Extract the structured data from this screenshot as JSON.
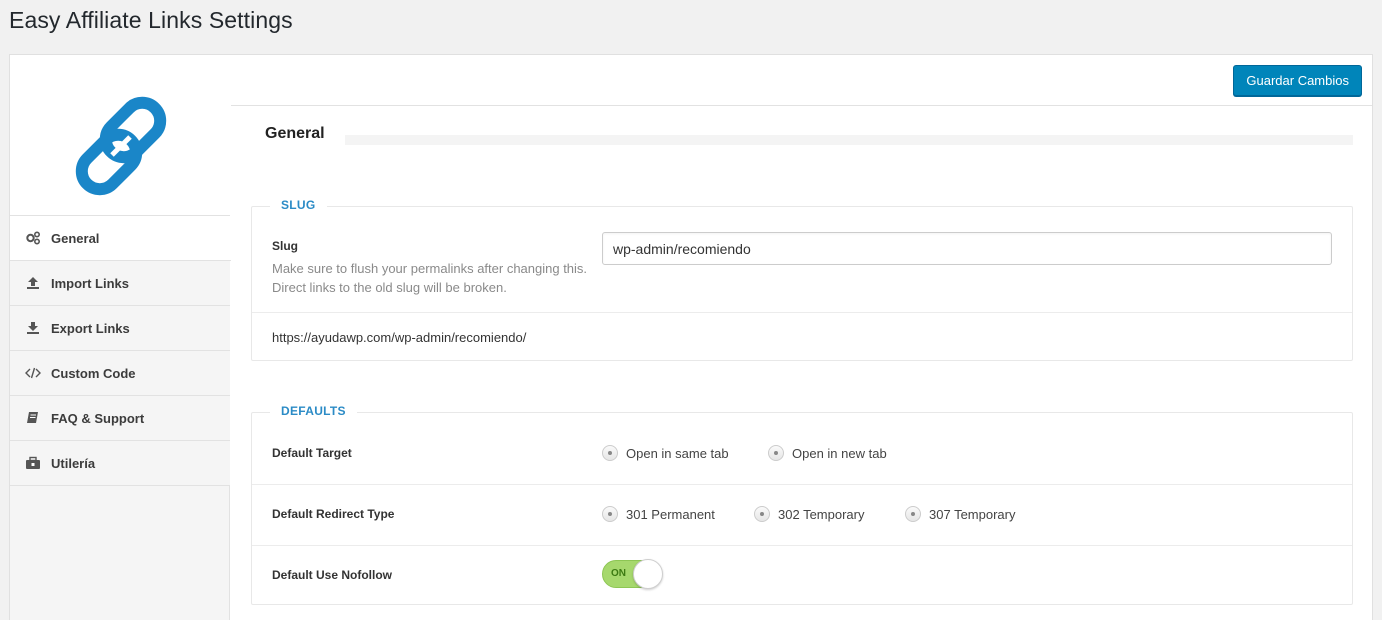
{
  "page": {
    "title": "Easy Affiliate Links Settings"
  },
  "colors": {
    "accent": "#0085ba",
    "legend": "#2b8bc6",
    "logo": "#1a86c8",
    "toggle_on": "#a6d86d"
  },
  "sidebar": {
    "logo_icon": "chain-link-icon",
    "items": [
      {
        "label": "General",
        "icon": "gears-icon",
        "active": true
      },
      {
        "label": "Import Links",
        "icon": "upload-icon",
        "active": false
      },
      {
        "label": "Export Links",
        "icon": "download-icon",
        "active": false
      },
      {
        "label": "Custom Code",
        "icon": "code-icon",
        "active": false
      },
      {
        "label": "FAQ & Support",
        "icon": "book-icon",
        "active": false
      },
      {
        "label": "Utilería",
        "icon": "toolbox-icon",
        "active": false
      }
    ]
  },
  "toolbar": {
    "save_label": "Guardar Cambios"
  },
  "section": {
    "title": "General"
  },
  "slug": {
    "legend": "SLUG",
    "label": "Slug",
    "description": "Make sure to flush your permalinks after changing this. Direct links to the old slug will be broken.",
    "value": "wp-admin/recomiendo",
    "url": "https://ayudawp.com/wp-admin/recomiendo/"
  },
  "defaults": {
    "legend": "DEFAULTS",
    "target": {
      "label": "Default Target",
      "options": [
        "Open in same tab",
        "Open in new tab"
      ]
    },
    "redirect": {
      "label": "Default Redirect Type",
      "options": [
        "301 Permanent",
        "302 Temporary",
        "307 Temporary"
      ]
    },
    "nofollow": {
      "label": "Default Use Nofollow",
      "toggle_text": "ON",
      "enabled": true
    }
  }
}
